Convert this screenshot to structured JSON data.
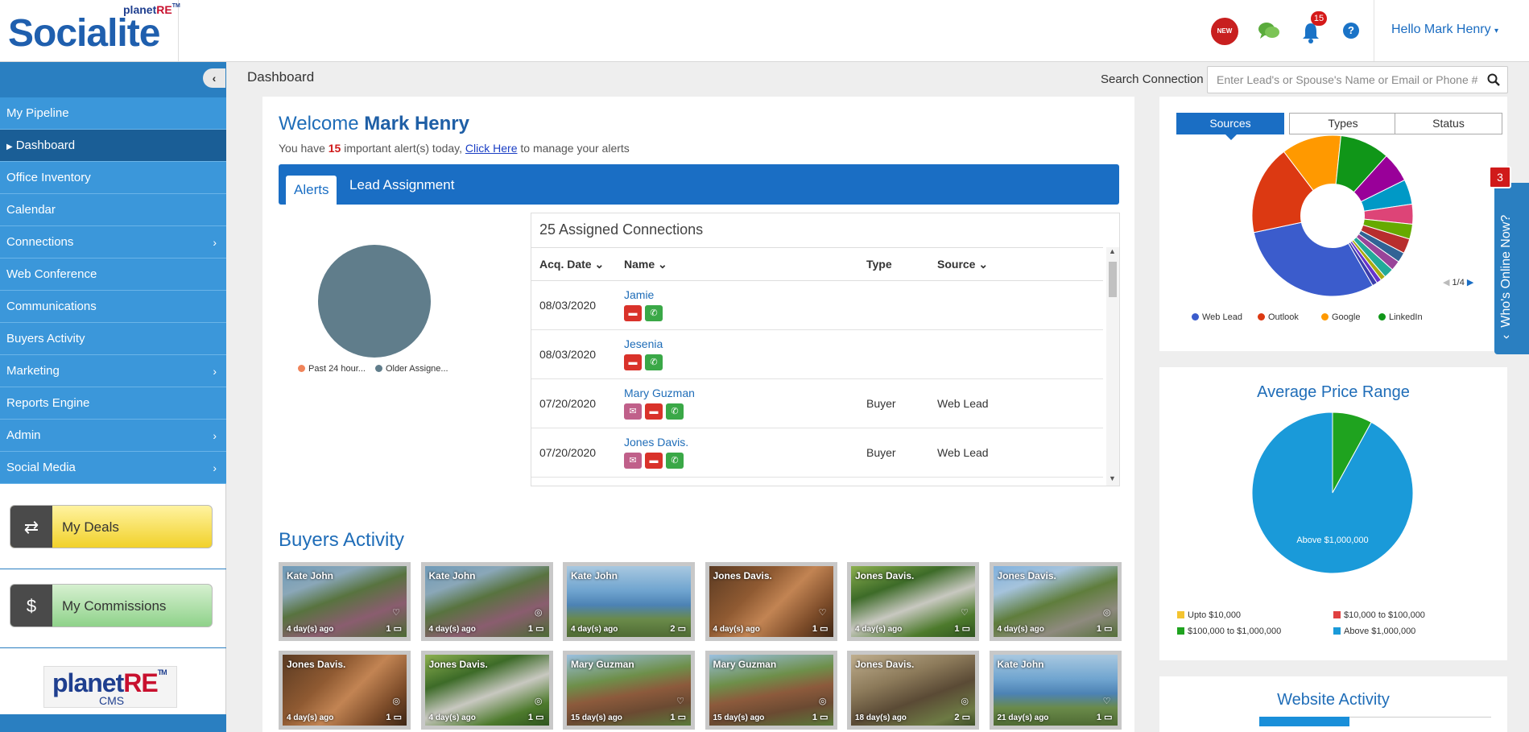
{
  "header": {
    "brand_small": "planet",
    "brand_small_re": "RE",
    "brand_tm": "TM",
    "brand_main": "Socialite",
    "new_badge": "NEW",
    "notifications_count": "15",
    "help_glyph": "?",
    "greeting": "Hello Mark Henry"
  },
  "sidebar": {
    "items": [
      {
        "label": "My Pipeline",
        "active": false,
        "has_submenu": false
      },
      {
        "label": "Dashboard",
        "active": true,
        "has_submenu": false
      },
      {
        "label": "Office Inventory",
        "active": false,
        "has_submenu": false
      },
      {
        "label": "Calendar",
        "active": false,
        "has_submenu": false
      },
      {
        "label": "Connections",
        "active": false,
        "has_submenu": true
      },
      {
        "label": "Web Conference",
        "active": false,
        "has_submenu": false
      },
      {
        "label": "Communications",
        "active": false,
        "has_submenu": false
      },
      {
        "label": "Buyers Activity",
        "active": false,
        "has_submenu": false
      },
      {
        "label": "Marketing",
        "active": false,
        "has_submenu": true
      },
      {
        "label": "Reports Engine",
        "active": false,
        "has_submenu": false
      },
      {
        "label": "Admin",
        "active": false,
        "has_submenu": true
      },
      {
        "label": "Social Media",
        "active": false,
        "has_submenu": true
      }
    ],
    "deals_label": "My Deals",
    "commissions_label": "My Commissions",
    "cms_main": "planet",
    "cms_re": "RE",
    "cms_tm": "TM",
    "cms_sub": "CMS"
  },
  "page": {
    "title": "Dashboard",
    "search_label": "Search Connection",
    "search_placeholder": "Enter Lead's or Spouse's Name or Email or Phone #"
  },
  "welcome": {
    "prefix": "Welcome ",
    "name": "Mark Henry",
    "alert_pre": "You have ",
    "alert_count": "15",
    "alert_mid": " important alert(s) today, ",
    "alert_link": "Click Here",
    "alert_post": " to manage your alerts"
  },
  "tabs": {
    "alerts": "Alerts",
    "lead_assignment": "Lead Assignment"
  },
  "mini_chart": {
    "legend": [
      {
        "label": "Past 24 hour...",
        "color": "#f0845a"
      },
      {
        "label": "Older Assigne...",
        "color": "#607d8b"
      }
    ]
  },
  "connections": {
    "title": "25 Assigned Connections",
    "columns": {
      "date": "Acq. Date",
      "name": "Name",
      "type": "Type",
      "source": "Source"
    },
    "rows": [
      {
        "date": "08/03/2020",
        "name": "Jamie",
        "type": "",
        "source": "",
        "actions": [
          "sms",
          "call"
        ]
      },
      {
        "date": "08/03/2020",
        "name": "Jesenia",
        "type": "",
        "source": "",
        "actions": [
          "sms",
          "call"
        ]
      },
      {
        "date": "07/20/2020",
        "name": "Mary Guzman",
        "type": "Buyer",
        "source": "Web Lead",
        "actions": [
          "mail",
          "sms",
          "call"
        ]
      },
      {
        "date": "07/20/2020",
        "name": "Jones Davis.",
        "type": "Buyer",
        "source": "Web Lead",
        "actions": [
          "mail",
          "sms",
          "call"
        ]
      }
    ]
  },
  "buyers_activity": {
    "title": "Buyers Activity",
    "tiles": [
      {
        "name": "Kate John",
        "ago": "4 day(s) ago",
        "count": "1",
        "icon": "heart-icon",
        "bg": "garden"
      },
      {
        "name": "Kate John",
        "ago": "4 day(s) ago",
        "count": "1",
        "icon": "glasses-icon",
        "bg": "garden"
      },
      {
        "name": "Kate John",
        "ago": "4 day(s) ago",
        "count": "2",
        "icon": "",
        "bg": "ocean"
      },
      {
        "name": "Jones Davis.",
        "ago": "4 day(s) ago",
        "count": "1",
        "icon": "heart-icon",
        "bg": "room"
      },
      {
        "name": "Jones Davis.",
        "ago": "4 day(s) ago",
        "count": "1",
        "icon": "heart-icon",
        "bg": "garage"
      },
      {
        "name": "Jones Davis.",
        "ago": "4 day(s) ago",
        "count": "1",
        "icon": "glasses-icon",
        "bg": "driveway"
      },
      {
        "name": "Jones Davis.",
        "ago": "4 day(s) ago",
        "count": "1",
        "icon": "glasses-icon",
        "bg": "room"
      },
      {
        "name": "Jones Davis.",
        "ago": "4 day(s) ago",
        "count": "1",
        "icon": "glasses-icon",
        "bg": "garage"
      },
      {
        "name": "Mary Guzman",
        "ago": "15 day(s) ago",
        "count": "1",
        "icon": "heart-icon",
        "bg": "house"
      },
      {
        "name": "Mary Guzman",
        "ago": "15 day(s) ago",
        "count": "1",
        "icon": "glasses-icon",
        "bg": "house"
      },
      {
        "name": "Jones Davis.",
        "ago": "18 day(s) ago",
        "count": "2",
        "icon": "glasses-icon",
        "bg": "stone"
      },
      {
        "name": "Kate John",
        "ago": "21 day(s) ago",
        "count": "1",
        "icon": "heart-icon",
        "bg": "ocean"
      }
    ]
  },
  "sources_panel": {
    "tabs": [
      "Sources",
      "Types",
      "Status"
    ],
    "legend": [
      {
        "label": "Web Lead",
        "color": "#3b5ccc"
      },
      {
        "label": "Outlook",
        "color": "#dc3912"
      },
      {
        "label": "Google",
        "color": "#ff9900"
      },
      {
        "label": "LinkedIn",
        "color": "#109618"
      }
    ],
    "pager": "1/4"
  },
  "price_panel": {
    "title": "Average Price Range",
    "legend": [
      {
        "label": "Upto $10,000",
        "color": "#f4c430"
      },
      {
        "label": "$10,000 to $100,000",
        "color": "#e04040"
      },
      {
        "label": "$100,000 to $1,000,000",
        "color": "#1fa31f"
      },
      {
        "label": "Above $1,000,000",
        "color": "#1a9ad9"
      }
    ]
  },
  "website_panel": {
    "title": "Website Activity"
  },
  "whos_online": {
    "label": "Who's Online Now?",
    "count": "3"
  },
  "chart_data": [
    {
      "type": "pie",
      "labels": [
        "Web Lead",
        "Outlook",
        "Google",
        "LinkedIn"
      ],
      "values": [
        30,
        18,
        12,
        10,
        6,
        5,
        4,
        3,
        3,
        2,
        2,
        2,
        1,
        1,
        1
      ],
      "colors": [
        "#3b5ccc",
        "#dc3912",
        "#ff9900",
        "#109618",
        "#990099",
        "#0099c6",
        "#dd4477",
        "#66aa00",
        "#b82e2e",
        "#316395",
        "#994499",
        "#22aa99",
        "#aaaa11",
        "#6633cc",
        "#3b3eac"
      ],
      "donut": true
    },
    {
      "type": "pie",
      "labels": [
        "Upto $10,000",
        "$10,000 to $100,000",
        "$100,000 to $1,000,000",
        "Above $1,000,000"
      ],
      "values": [
        0,
        0,
        8,
        92
      ],
      "slice_label": "Above $1,000,000",
      "colors": [
        "#f4c430",
        "#e04040",
        "#1fa31f",
        "#1a9ad9"
      ]
    }
  ]
}
